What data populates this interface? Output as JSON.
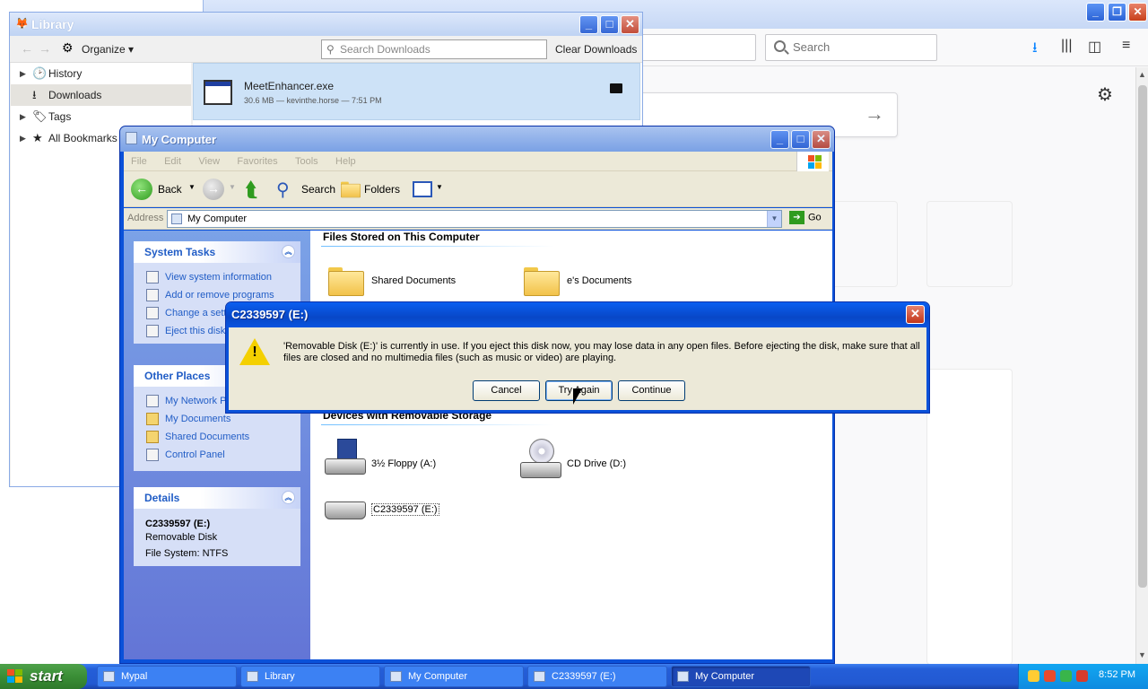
{
  "firefox": {
    "search_placeholder": "Search"
  },
  "library": {
    "title": "Library",
    "organize_label": "Organize",
    "search_placeholder": "Search Downloads",
    "clear_label": "Clear Downloads",
    "nav": [
      {
        "label": "History"
      },
      {
        "label": "Downloads"
      },
      {
        "label": "Tags"
      },
      {
        "label": "All Bookmarks"
      }
    ],
    "download": {
      "name": "MeetEnhancer.exe",
      "meta": "30.6 MB — kevinthe.horse — 7:51 PM"
    }
  },
  "mycomputer": {
    "title": "My Computer",
    "menu": [
      "File",
      "Edit",
      "View",
      "Favorites",
      "Tools",
      "Help"
    ],
    "toolbar": {
      "back": "Back",
      "search": "Search",
      "folders": "Folders"
    },
    "address_label": "Address",
    "address_value": "My Computer",
    "go_label": "Go",
    "system_tasks": {
      "title": "System Tasks",
      "items": [
        "View system information",
        "Add or remove programs",
        "Change a setting",
        "Eject this disk"
      ]
    },
    "other_places": {
      "title": "Other Places",
      "items": [
        "My Network Places",
        "My Documents",
        "Shared Documents",
        "Control Panel"
      ]
    },
    "details": {
      "title": "Details",
      "name": "C2339597 (E:)",
      "type": "Removable Disk",
      "fs": "File System: NTFS"
    },
    "files_heading": "Files Stored on This Computer",
    "files": [
      "Shared Documents",
      "e's Documents"
    ],
    "devices_heading": "Devices with Removable Storage",
    "devices": [
      "3½ Floppy (A:)",
      "CD Drive (D:)",
      "C2339597 (E:)"
    ]
  },
  "dialog": {
    "title": "C2339597 (E:)",
    "message": "'Removable Disk (E:)' is currently in use.  If you eject this disk now, you may lose data in any open files.  Before ejecting the disk, make sure that all files are closed and no multimedia files (such as music or video) are playing.",
    "buttons": {
      "cancel": "Cancel",
      "try_again": "Try Again",
      "continue": "Continue"
    }
  },
  "taskbar": {
    "start_label": "start",
    "tasks": [
      "Mypal",
      "Library",
      "My Computer",
      "C2339597 (E:)",
      "My Computer"
    ],
    "clock": "8:52 PM"
  },
  "colors": {
    "xp_blue": "#0a51d9",
    "task_link": "#215dc6",
    "dialog_face": "#ece9d8"
  }
}
